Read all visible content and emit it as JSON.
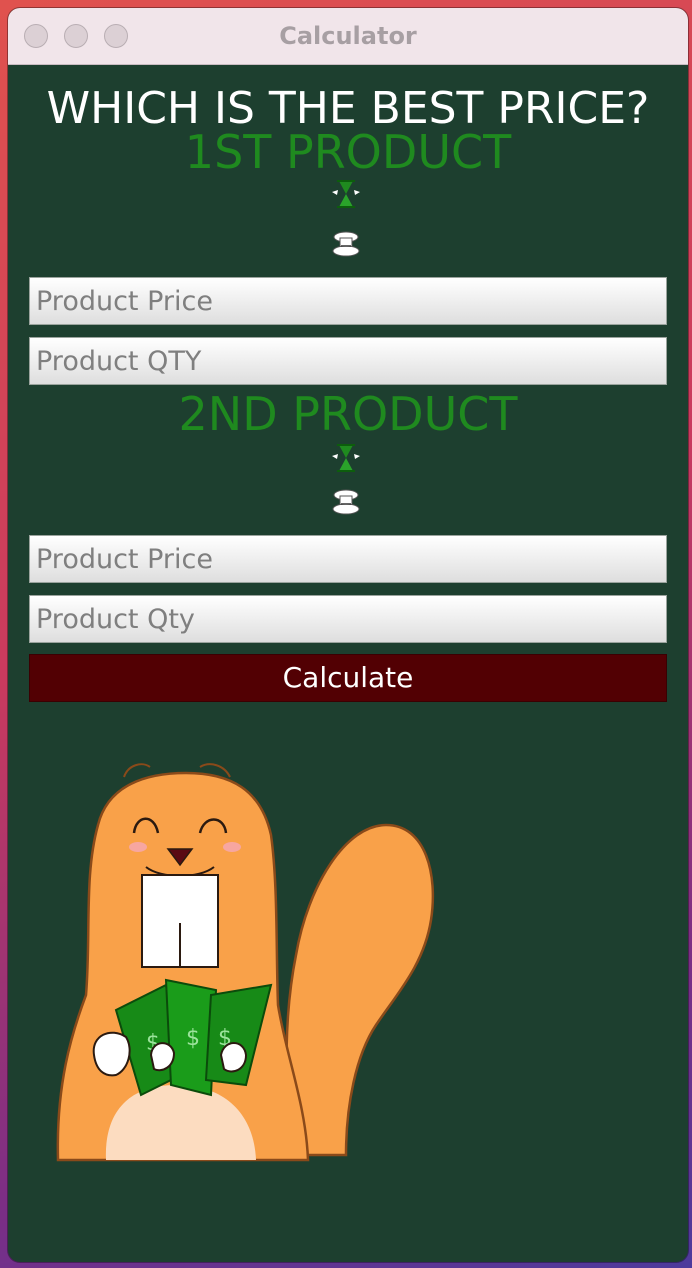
{
  "window": {
    "title": "Calculator",
    "controls": [
      "close",
      "minimize",
      "zoom"
    ]
  },
  "page": {
    "heading": "WHICH IS THE BEST PRICE?"
  },
  "products": [
    {
      "title": "1ST PRODUCT",
      "icons": [
        "hourglass-icon",
        "scale-icon"
      ],
      "price_placeholder": "Product Price",
      "qty_placeholder": "Product QTY"
    },
    {
      "title": "2ND PRODUCT",
      "icons": [
        "hourglass-icon",
        "scale-icon"
      ],
      "price_placeholder": "Product Price",
      "qty_placeholder": "Product Qty"
    }
  ],
  "actions": {
    "calculate_label": "Calculate"
  },
  "colors": {
    "background": "#1d3f2f",
    "product_title": "#1f8a1f",
    "button": "#520003",
    "titlebar": "#f1e5ea"
  },
  "illustration": {
    "icon": "squirrel-with-money-icon"
  }
}
